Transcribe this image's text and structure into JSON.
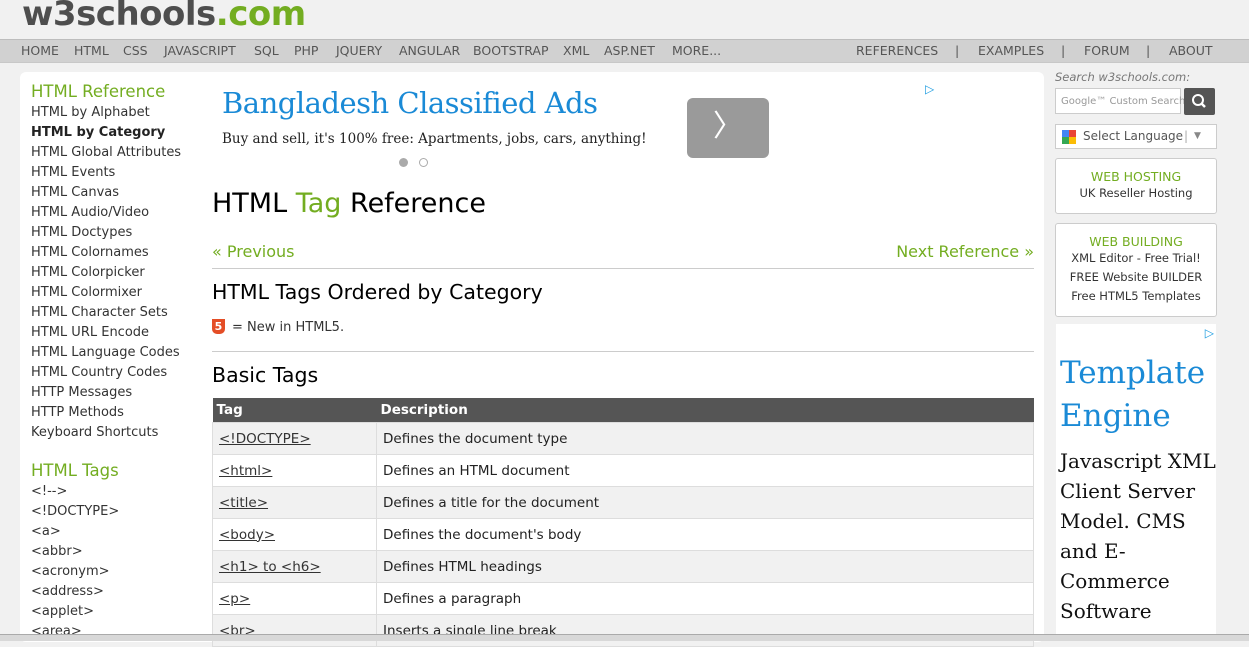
{
  "logo": {
    "part1": "w3schools",
    "part2": ".com"
  },
  "topnav": {
    "left": [
      "HOME",
      "HTML",
      "CSS",
      "JAVASCRIPT",
      "SQL",
      "PHP",
      "JQUERY",
      "ANGULAR",
      "BOOTSTRAP",
      "XML",
      "ASP.NET",
      "MORE..."
    ],
    "right": [
      "REFERENCES",
      "EXAMPLES",
      "FORUM",
      "ABOUT"
    ],
    "separator": "|"
  },
  "sidebar": {
    "ref_heading": "HTML Reference",
    "ref_items": [
      "HTML by Alphabet",
      "HTML by Category",
      "HTML Global Attributes",
      "HTML Events",
      "HTML Canvas",
      "HTML Audio/Video",
      "HTML Doctypes",
      "HTML Colornames",
      "HTML Colorpicker",
      "HTML Colormixer",
      "HTML Character Sets",
      "HTML URL Encode",
      "HTML Language Codes",
      "HTML Country Codes",
      "HTTP Messages",
      "HTTP Methods",
      "Keyboard Shortcuts"
    ],
    "tags_heading": "HTML Tags",
    "tag_items": [
      "<!-->",
      "<!DOCTYPE>",
      "<a>",
      "<abbr>",
      "<acronym>",
      "<address>",
      "<applet>",
      "<area>"
    ]
  },
  "ad": {
    "title": "Bangladesh Classified Ads",
    "subtitle": "Buy and sell, it's 100% free: Apartments, jobs, cars, anything!",
    "button_glyph": "〉",
    "choices_glyph": "▷"
  },
  "main": {
    "title_pre": "HTML ",
    "title_mid": "Tag",
    "title_post": " Reference",
    "prev": "« Previous",
    "next": "Next Reference »",
    "h2": "HTML Tags Ordered by Category",
    "html5_badge": "5",
    "html5_note": "= New in HTML5.",
    "h3": "Basic Tags",
    "table": {
      "headers": [
        "Tag",
        "Description"
      ],
      "rows": [
        [
          "<!DOCTYPE>",
          "Defines the document type"
        ],
        [
          "<html>",
          "Defines an HTML document"
        ],
        [
          "<title>",
          "Defines a title for the document"
        ],
        [
          "<body>",
          "Defines the document's body"
        ],
        [
          "<h1> to <h6>",
          "Defines HTML headings"
        ],
        [
          "<p>",
          "Defines a paragraph"
        ],
        [
          "<br>",
          "Inserts a single line break"
        ]
      ]
    }
  },
  "right": {
    "search_label": "Search w3schools.com:",
    "search_placeholder": "Google™ Custom Search",
    "language": "Select Language",
    "language_sep": "|",
    "language_arrow": "▼",
    "hosting_title": "WEB HOSTING",
    "hosting_items": [
      "UK Reseller Hosting"
    ],
    "building_title": "WEB BUILDING",
    "building_items": [
      "XML Editor - Free Trial!",
      "FREE Website BUILDER",
      "Free HTML5 Templates"
    ],
    "ad_title": "Template Engine",
    "ad_body": "Javascript XML Client Server Model. CMS and E-Commerce Software"
  },
  "colors": {
    "brand_green": "#73ad21",
    "ad_blue": "#1a8ad6",
    "nav_bg": "#d1d1d1",
    "table_header": "#555555"
  }
}
